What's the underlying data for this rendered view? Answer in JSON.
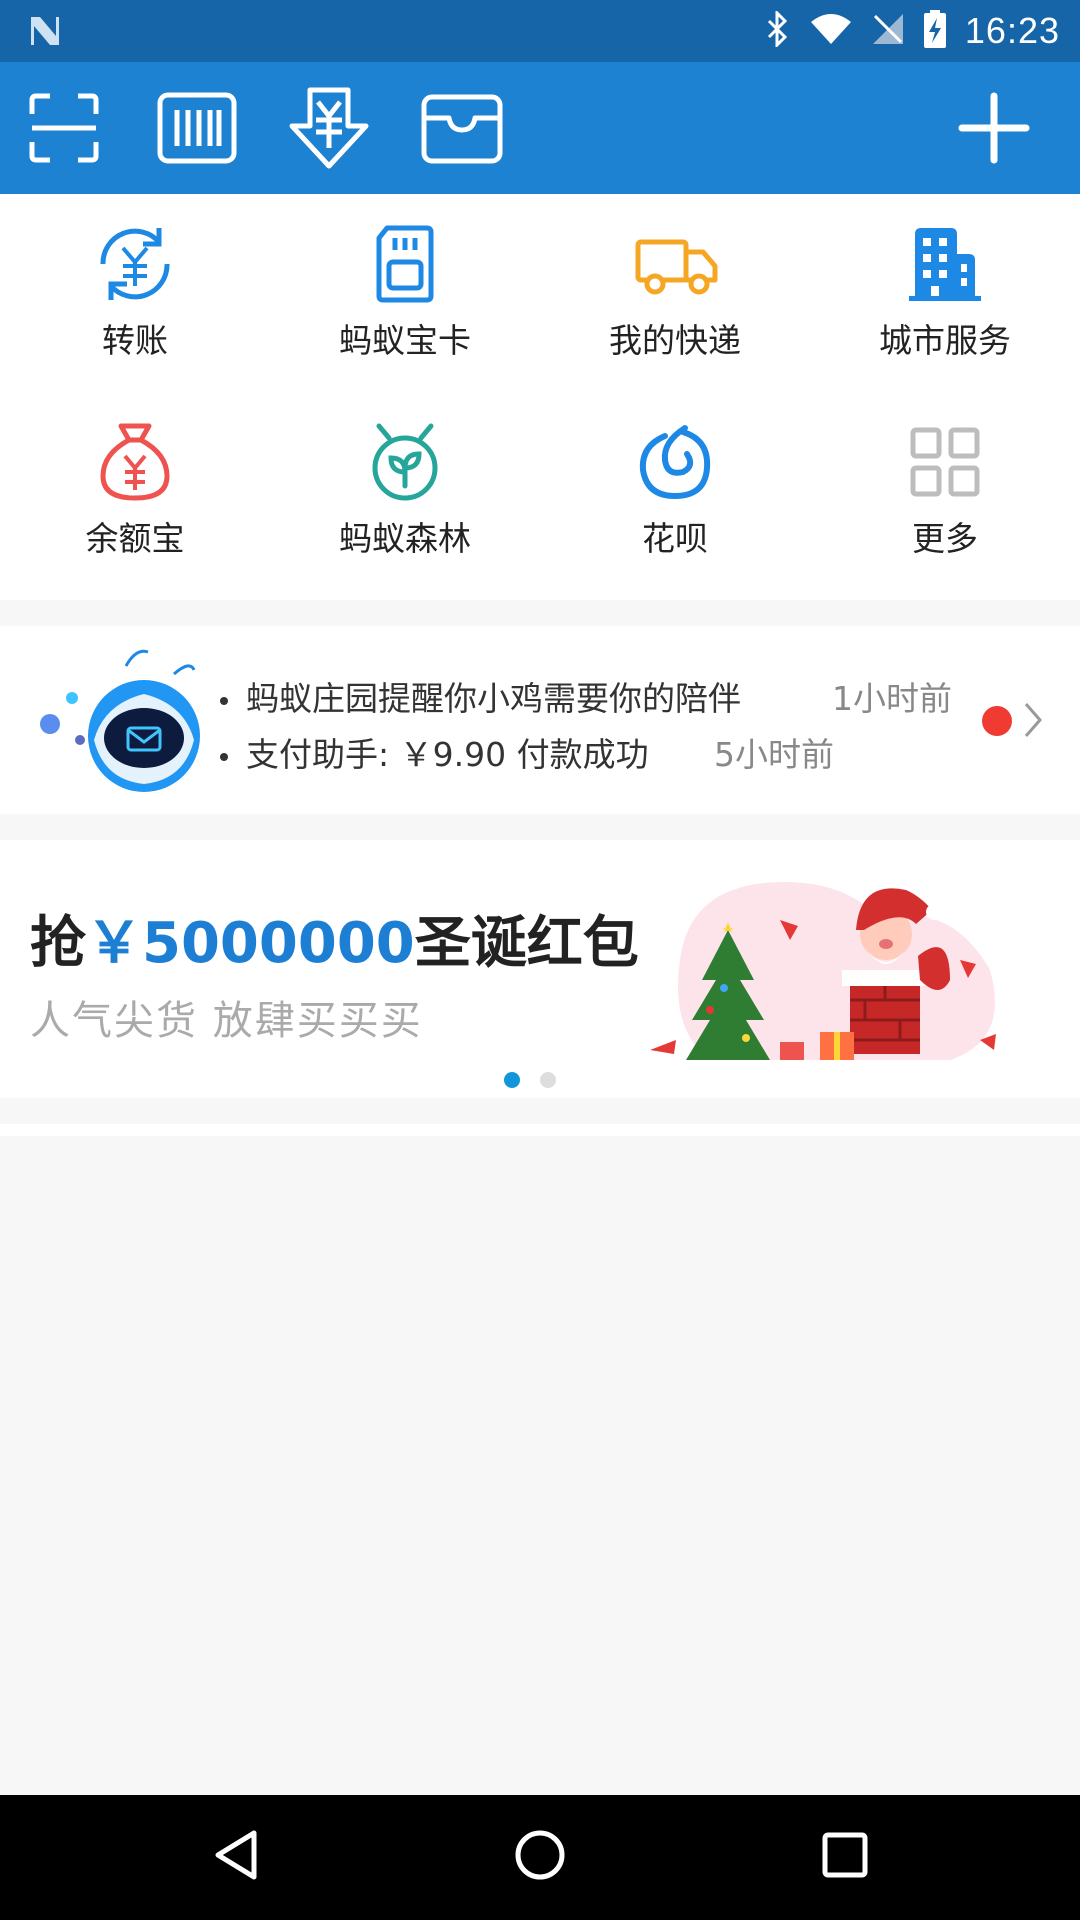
{
  "status_bar": {
    "time": "16:23",
    "icons": [
      "notification-n-icon",
      "bluetooth-icon",
      "wifi-icon",
      "no-sim-icon",
      "battery-charging-icon"
    ]
  },
  "toolbar": {
    "icons": [
      "scan-icon",
      "pay-code-icon",
      "receive-money-icon",
      "card-wallet-icon",
      "add-icon"
    ]
  },
  "shortcuts": [
    {
      "label": "转账",
      "icon": "transfer-icon",
      "color": "#1e88e5"
    },
    {
      "label": "蚂蚁宝卡",
      "icon": "sim-card-icon",
      "color": "#1e88e5"
    },
    {
      "label": "我的快递",
      "icon": "truck-icon",
      "color": "#f5a623"
    },
    {
      "label": "城市服务",
      "icon": "building-icon",
      "color": "#1e88e5"
    },
    {
      "label": "余额宝",
      "icon": "money-bag-icon",
      "color": "#ef5350"
    },
    {
      "label": "蚂蚁森林",
      "icon": "sprout-icon",
      "color": "#26a69a"
    },
    {
      "label": "花呗",
      "icon": "huabei-icon",
      "color": "#1e88e5"
    },
    {
      "label": "更多",
      "icon": "more-grid-icon",
      "color": "#bdbdbd"
    }
  ],
  "notifications": [
    {
      "text": "蚂蚁庄园提醒你小鸡需要你的陪伴",
      "time": "1小时前"
    },
    {
      "text": "支付助手: ￥9.90 付款成功",
      "time": "5小时前"
    }
  ],
  "banner": {
    "prefix": "抢",
    "amount": "￥5000000",
    "suffix": "圣诞红包",
    "subtitle": "人气尖货 放肆买买买",
    "active_page": 1,
    "pages": 2
  },
  "colors": {
    "status_bar": "#1565a8",
    "toolbar": "#1d82d2",
    "accent": "#1d7fd4",
    "badge": "#f03b32"
  }
}
